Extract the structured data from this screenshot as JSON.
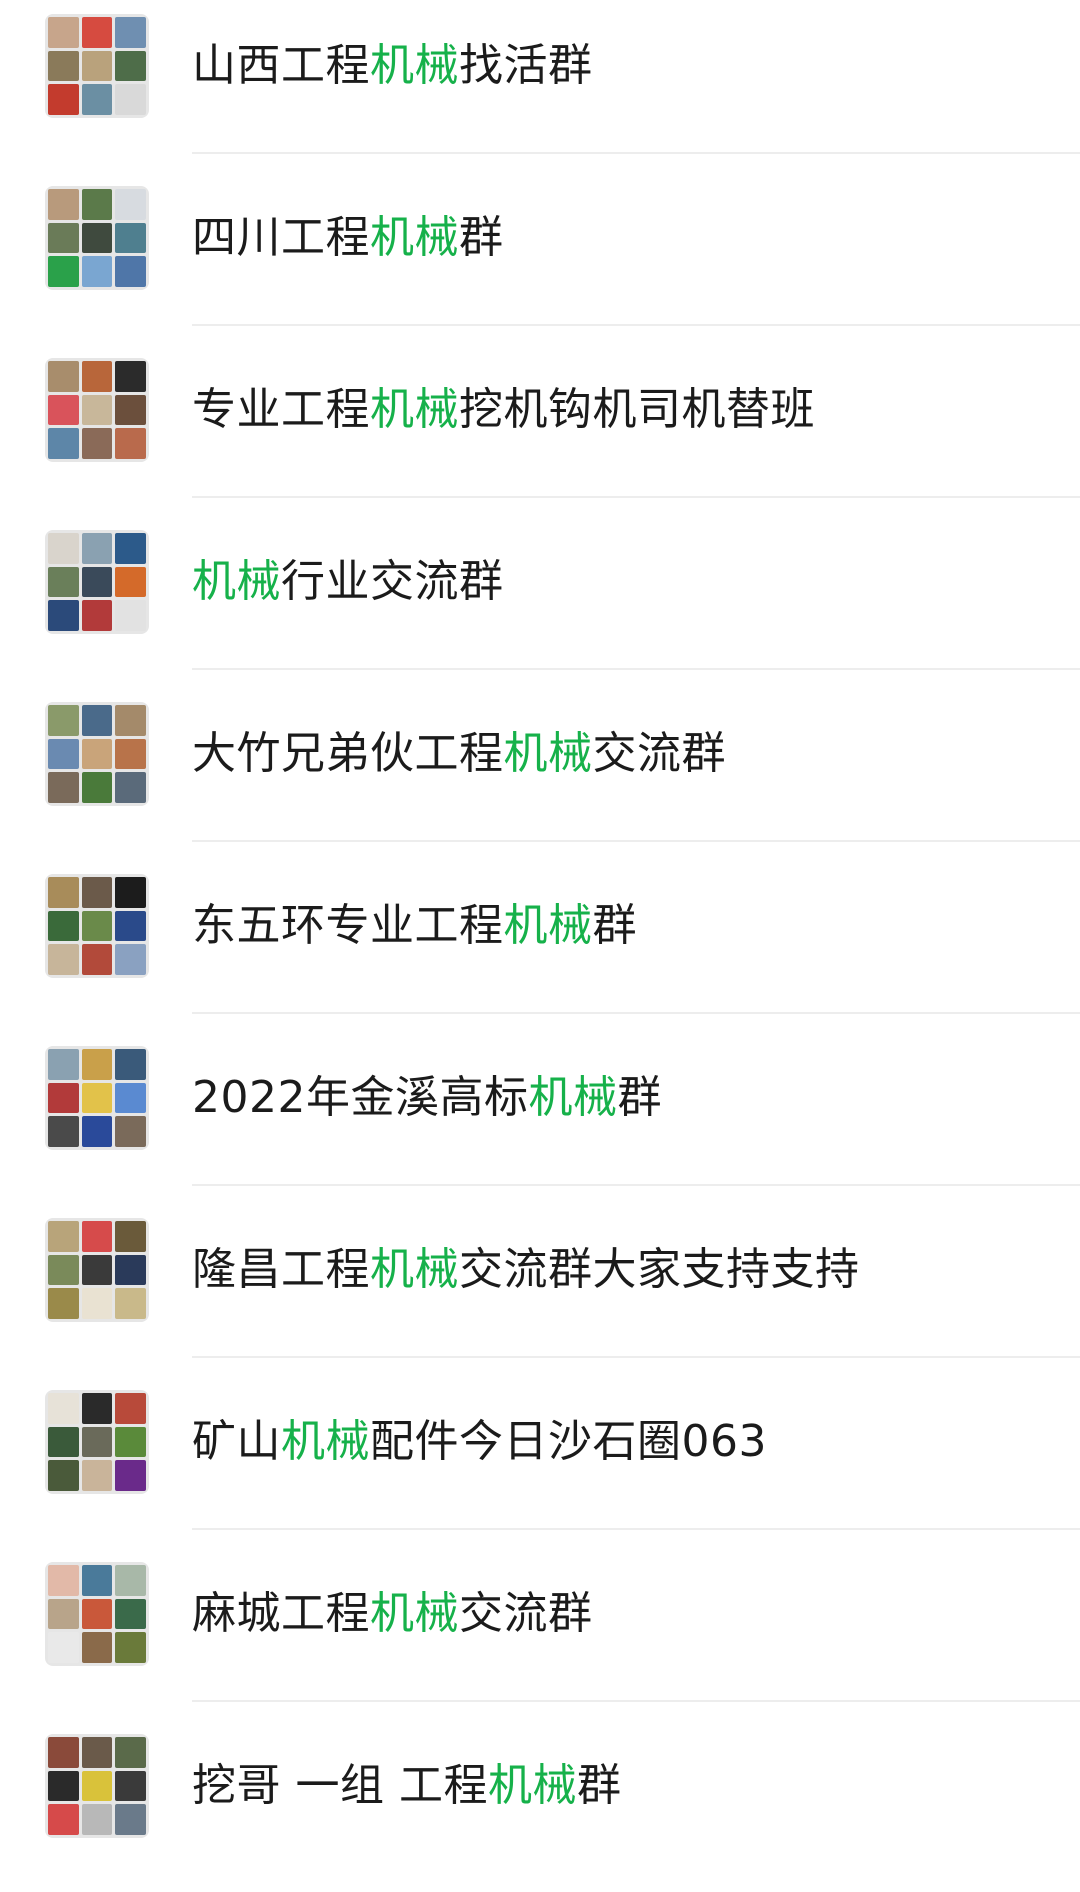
{
  "highlight_color": "#16b14a",
  "groups": [
    {
      "pre": "山西工程",
      "hl": "机械",
      "post": "找活群",
      "avatar": [
        "#c7a58b",
        "#d64b40",
        "#6f8fb1",
        "#8a7a5a",
        "#b9a27c",
        "#4e6d49",
        "#c33b2d",
        "#6b8fa3",
        "#d9d9d9"
      ]
    },
    {
      "pre": "四川工程",
      "hl": "机械",
      "post": "群",
      "avatar": [
        "#b89a7c",
        "#5b7a4a",
        "#d7dbe0",
        "#6a7b58",
        "#3f4a3e",
        "#4f7f8f",
        "#2aa14a",
        "#7aa6d1",
        "#4f76a8"
      ]
    },
    {
      "pre": "专业工程",
      "hl": "机械",
      "post": "挖机钩机司机替班",
      "avatar": [
        "#a88d6c",
        "#b8663a",
        "#2b2b2b",
        "#d9535b",
        "#c8b79a",
        "#6b4f3c",
        "#5d86a8",
        "#8a6a58",
        "#b96a4c"
      ]
    },
    {
      "pre": "",
      "hl": "机械",
      "post": "行业交流群",
      "avatar": [
        "#d9d4cc",
        "#8aa1b1",
        "#2c5a8a",
        "#6a7f5a",
        "#3a4a5a",
        "#d46a2a",
        "#2b4a7a",
        "#b23a3a",
        "#e2e2e2"
      ]
    },
    {
      "pre": "大竹兄弟伙工程",
      "hl": "机械",
      "post": "交流群",
      "avatar": [
        "#8a9a6a",
        "#4a6a8a",
        "#a48a6a",
        "#6a8ab1",
        "#c9a47a",
        "#b8734a",
        "#7a6a5a",
        "#4a7a3a",
        "#5a6a7a"
      ]
    },
    {
      "pre": "东五环专业工程",
      "hl": "机械",
      "post": "群",
      "avatar": [
        "#a88c5a",
        "#6b5a4a",
        "#1c1c1c",
        "#3a6a3a",
        "#6a8a4a",
        "#2a4a8a",
        "#c7b59a",
        "#b24a3a",
        "#8aa1c1"
      ]
    },
    {
      "pre": "2022年金溪高标",
      "hl": "机械",
      "post": "群",
      "avatar": [
        "#8aa1b1",
        "#c9a04a",
        "#3a5a7a",
        "#b23a3a",
        "#e2c24a",
        "#5a8ad1",
        "#4a4a4a",
        "#2a4a9a",
        "#7a6a5a"
      ]
    },
    {
      "pre": "隆昌工程",
      "hl": "机械",
      "post": "交流群大家支持支持",
      "avatar": [
        "#b8a47a",
        "#d64b4b",
        "#6a5a3a",
        "#7a8a5a",
        "#3a3a3a",
        "#2a3a5a",
        "#9a8a4a",
        "#e9e2d2",
        "#c9b98a"
      ]
    },
    {
      "pre": "矿山",
      "hl": "机械",
      "post": "配件今日沙石圈063",
      "avatar": [
        "#e7e2d8",
        "#2a2a2a",
        "#b84a3a",
        "#3a5a3a",
        "#6a6a5a",
        "#5a8a3a",
        "#4a5a3a",
        "#c9b49a",
        "#6a2a8a"
      ]
    },
    {
      "pre": "麻城工程",
      "hl": "机械",
      "post": "交流群",
      "avatar": [
        "#e2b9a8",
        "#4a7a9a",
        "#a8b8a8",
        "#b8a48a",
        "#c9583a",
        "#3a6a4a",
        "#e9e9e9",
        "#8a6a4a",
        "#6a7a3a"
      ]
    },
    {
      "pre": "挖哥 一组 工程",
      "hl": "机械",
      "post": "群",
      "avatar": [
        "#8a4a3a",
        "#6a5a4a",
        "#5a6a4a",
        "#2a2a2a",
        "#d9c23a",
        "#3a3a3a",
        "#d64a4a",
        "#b8b8b8",
        "#6a7a8a"
      ]
    }
  ]
}
